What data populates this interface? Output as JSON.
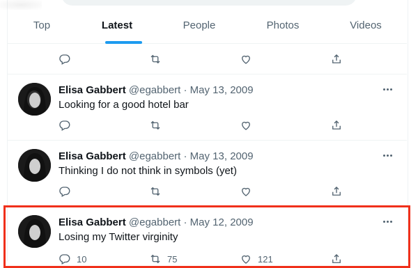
{
  "tabs": [
    {
      "label": "Top"
    },
    {
      "label": "Latest"
    },
    {
      "label": "People"
    },
    {
      "label": "Photos"
    },
    {
      "label": "Videos"
    }
  ],
  "active_tab": "Latest",
  "tweets": [
    {
      "name": "Elisa Gabbert",
      "handle": "@egabbert",
      "separator": "·",
      "date": "May 13, 2009",
      "text": "Looking for a good hotel bar"
    },
    {
      "name": "Elisa Gabbert",
      "handle": "@egabbert",
      "separator": "·",
      "date": "May 13, 2009",
      "text": "Thinking I do not think in symbols (yet)"
    },
    {
      "name": "Elisa Gabbert",
      "handle": "@egabbert",
      "separator": "·",
      "date": "May 12, 2009",
      "text": "Losing my Twitter virginity",
      "counts": {
        "replies": "10",
        "retweets": "75",
        "likes": "121"
      },
      "highlighted": true
    }
  ],
  "colors": {
    "accent": "#1d9bf0",
    "highlight_border": "#f0301b",
    "muted_text": "#536471"
  },
  "icons": [
    "reply-icon",
    "retweet-icon",
    "like-icon",
    "share-icon",
    "more-icon"
  ]
}
